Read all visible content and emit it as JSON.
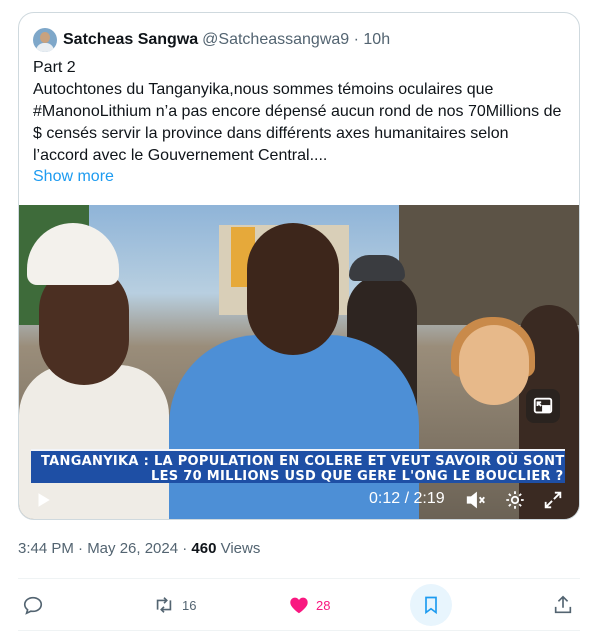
{
  "quoted_tweet": {
    "author_name": "Satcheas Sangwa",
    "author_handle": "@Satcheassangwa9 · 10h",
    "text": "Part 2\nAutochtones du Tanganyika,nous sommes témoins oculaires que #ManonoLithium n’a pas encore dépensé aucun rond de nos 70Millions de $ censés servir la province dans différents axes humanitaires selon l’accord avec le Gouvernement Central....",
    "show_more": "Show more"
  },
  "video": {
    "chyron_line1": "TANGANYIKA : LA POPULATION EN COLERE ET VEUT SAVOIR OÙ SONT",
    "chyron_line2": "LES 70 MILLIONS USD QUE GERE L'ONG LE BOUCLIER ?",
    "time": "0:12 / 2:19"
  },
  "meta": {
    "timestamp": "3:44 PM · May 26, 2024 · ",
    "views_count": "460",
    "views_label": " Views"
  },
  "actions": {
    "retweet_count": "16",
    "like_count": "28"
  },
  "colors": {
    "accent": "#1d9bf0",
    "like": "#f91880",
    "chyron_bg": "#1e4fa5"
  },
  "icons": [
    "reply-icon",
    "retweet-icon",
    "heart-icon",
    "bookmark-icon",
    "share-icon",
    "play-icon",
    "mute-icon",
    "settings-icon",
    "fullscreen-icon",
    "pip-icon"
  ]
}
